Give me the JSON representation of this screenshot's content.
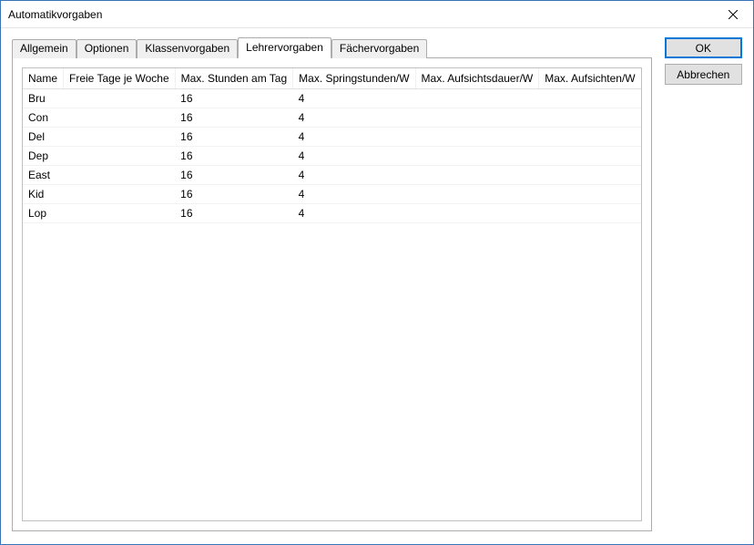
{
  "window": {
    "title": "Automatikvorgaben"
  },
  "buttons": {
    "ok": "OK",
    "cancel": "Abbrechen"
  },
  "tabs": {
    "allgemein": "Allgemein",
    "optionen": "Optionen",
    "klassen": "Klassenvorgaben",
    "lehrer": "Lehrervorgaben",
    "faecher": "Fächervorgaben"
  },
  "grid": {
    "headers": {
      "name": "Name",
      "freie_tage": "Freie Tage je Woche",
      "max_stunden": "Max. Stunden am Tag",
      "max_spring": "Max. Springstunden/W",
      "max_aufsichtsdauer": "Max. Aufsichtsdauer/W",
      "max_aufsichten": "Max. Aufsichten/W"
    },
    "rows": [
      {
        "name": "Bru",
        "freie_tage": "",
        "max_stunden": "16",
        "max_spring": "4",
        "max_aufsichtsdauer": "",
        "max_aufsichten": ""
      },
      {
        "name": "Con",
        "freie_tage": "",
        "max_stunden": "16",
        "max_spring": "4",
        "max_aufsichtsdauer": "",
        "max_aufsichten": ""
      },
      {
        "name": "Del",
        "freie_tage": "",
        "max_stunden": "16",
        "max_spring": "4",
        "max_aufsichtsdauer": "",
        "max_aufsichten": ""
      },
      {
        "name": "Dep",
        "freie_tage": "",
        "max_stunden": "16",
        "max_spring": "4",
        "max_aufsichtsdauer": "",
        "max_aufsichten": ""
      },
      {
        "name": "East",
        "freie_tage": "",
        "max_stunden": "16",
        "max_spring": "4",
        "max_aufsichtsdauer": "",
        "max_aufsichten": ""
      },
      {
        "name": "Kid",
        "freie_tage": "",
        "max_stunden": "16",
        "max_spring": "4",
        "max_aufsichtsdauer": "",
        "max_aufsichten": ""
      },
      {
        "name": "Lop",
        "freie_tage": "",
        "max_stunden": "16",
        "max_spring": "4",
        "max_aufsichtsdauer": "",
        "max_aufsichten": ""
      }
    ]
  }
}
